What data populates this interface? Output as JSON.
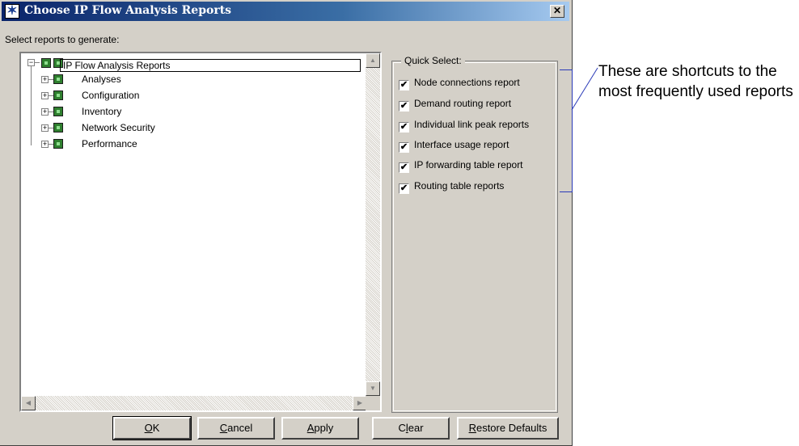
{
  "dialog": {
    "title": "Choose IP Flow Analysis Reports",
    "close_glyph": "✕",
    "prompt": "Select reports to generate:"
  },
  "tree": {
    "root": {
      "label": "IP Flow Analysis Reports",
      "expander": "−"
    },
    "children": [
      {
        "label": "Analyses",
        "expander": "+"
      },
      {
        "label": "Configuration",
        "expander": "+"
      },
      {
        "label": "Inventory",
        "expander": "+"
      },
      {
        "label": "Network Security",
        "expander": "+"
      },
      {
        "label": "Performance",
        "expander": "+"
      }
    ],
    "scroll_up": "▲",
    "scroll_down": "▼",
    "scroll_left": "◀",
    "scroll_right": "▶"
  },
  "quick_select": {
    "title": "Quick Select:",
    "items": [
      {
        "label": "Node connections report",
        "checked": true
      },
      {
        "label": "Demand routing report",
        "checked": true
      },
      {
        "label": "Individual link peak reports",
        "checked": true
      },
      {
        "label": "Interface usage report",
        "checked": true
      },
      {
        "label": "IP forwarding table report",
        "checked": true
      },
      {
        "label": "Routing table reports",
        "checked": true
      }
    ],
    "check_glyph": "✔"
  },
  "buttons": {
    "ok": {
      "key": "O",
      "rest": "K"
    },
    "cancel": {
      "key": "C",
      "rest": "ancel"
    },
    "apply": {
      "key": "A",
      "rest": "pply"
    },
    "clear": {
      "pre": "C",
      "key": "l",
      "rest": "ear"
    },
    "restore": {
      "key": "R",
      "rest": "estore Defaults"
    }
  },
  "annotation": {
    "text": "These are shortcuts to the most frequently used reports",
    "color": "#2a3ab8"
  },
  "colors": {
    "titlebar_start": "#0a246a",
    "face": "#d4d0c8",
    "tree_icon": "#2f7f2f"
  }
}
